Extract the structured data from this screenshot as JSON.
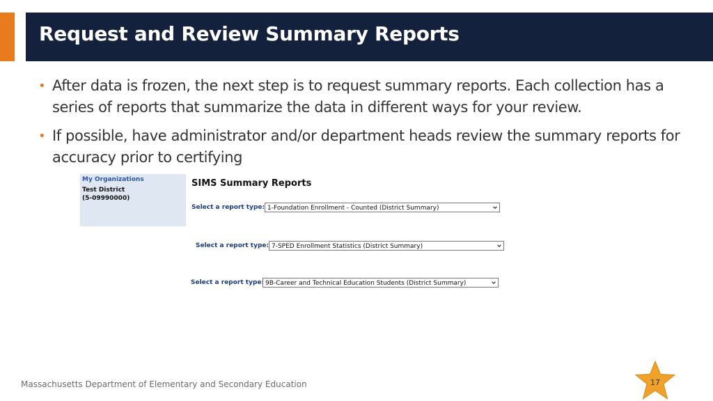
{
  "slide": {
    "title": "Request and Review Summary Reports",
    "bullets": [
      "After data is frozen, the next step is to request summary reports.  Each collection has a series of reports that summarize the data in different ways for your review.",
      "If possible, have administrator and/or department heads review the summary reports for accuracy prior to certifying"
    ],
    "bullet_symbol": "•",
    "footer": "Massachusetts Department of Elementary and Secondary Education",
    "page_number": "17",
    "colors": {
      "accent": "#e87b1e",
      "title_bar": "#14213d",
      "star": "#f0a12a"
    }
  },
  "screenshot": {
    "org_panel": {
      "header": "My Organizations",
      "name": "Test District",
      "code": "(5-09990000)"
    },
    "heading": "SIMS Summary Reports",
    "report_rows": [
      {
        "label": "Select a report type:",
        "selected": "1-Foundation Enrollment - Counted (District Summary)"
      },
      {
        "label": "Select a report type:",
        "selected": "7-SPED Enrollment Statistics (District Summary)"
      },
      {
        "label": "Select a report type:",
        "selected": "9B-Career and Technical Education Students (District Summary)"
      }
    ],
    "icons": {
      "dropdown": "chevron-down-icon",
      "page_badge": "star-icon"
    }
  }
}
